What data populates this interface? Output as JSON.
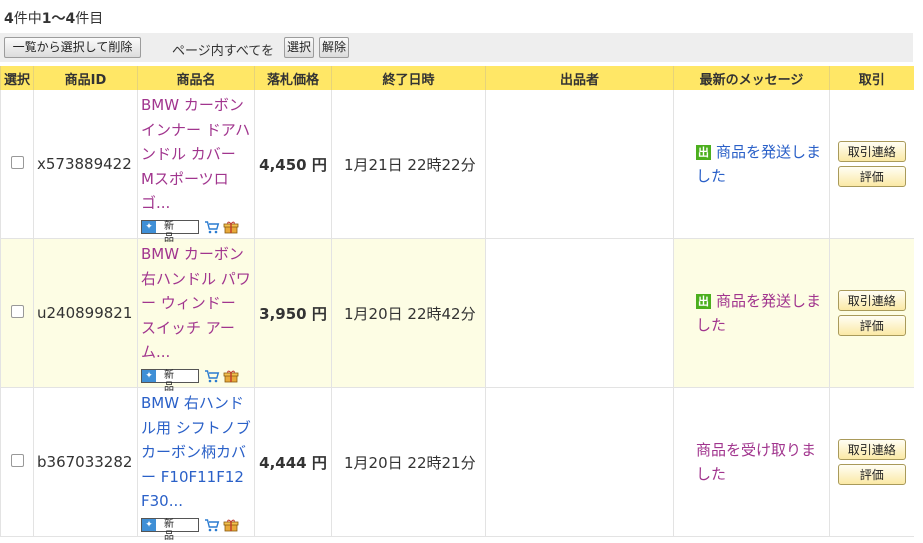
{
  "summary": {
    "total": "4",
    "total_suffix": "件中",
    "range": "1〜4",
    "range_suffix": "件目"
  },
  "toolbar": {
    "remove_label": "一覧から選択して削除",
    "page_all_label": "ページ内すべてを",
    "select_label": "選択",
    "deselect_label": "解除"
  },
  "columns": {
    "select": "選択",
    "item_id": "商品ID",
    "item_name": "商品名",
    "price": "落札価格",
    "end_time": "終了日時",
    "seller": "出品者",
    "message": "最新のメッセージ",
    "trade": "取引"
  },
  "rows": [
    {
      "id": "x573889422",
      "name": "BMW カーボンインナー ドアハンドル カバー Mスポーツロゴ...",
      "price": "4,450 円",
      "end": "1月21日 22時22分",
      "shipped_icon": "出",
      "message": "商品を発送しました",
      "contact": "取引連絡",
      "rate": "評価",
      "badge": "新 品",
      "badge_icon": "sparkle-icon"
    },
    {
      "id": "u240899821",
      "name": "BMW カーボン右ハンドル パワー ウィンドー スイッチ アーム...",
      "price": "3,950 円",
      "end": "1月20日 22時42分",
      "shipped_icon": "出",
      "message": "商品を発送しました",
      "contact": "取引連絡",
      "rate": "評価",
      "badge": "新 品",
      "badge_icon": "sparkle-icon"
    },
    {
      "id": "b367033282",
      "name": "BMW 右ハンドル用 シフトノブ カーボン柄カバー F10F11F12F30...",
      "price": "4,444 円",
      "end": "1月20日 22時21分",
      "message": "商品を受け取りました",
      "contact": "取引連絡",
      "rate": "評価",
      "badge": "新 品",
      "badge_icon": "sparkle-icon"
    }
  ],
  "colors": {
    "header_bg": "#ffe766",
    "alt_row_bg": "#fdfde4",
    "link": "#2a60c8",
    "visited": "#a1358e",
    "shipped_icon": "#4caf1e"
  }
}
